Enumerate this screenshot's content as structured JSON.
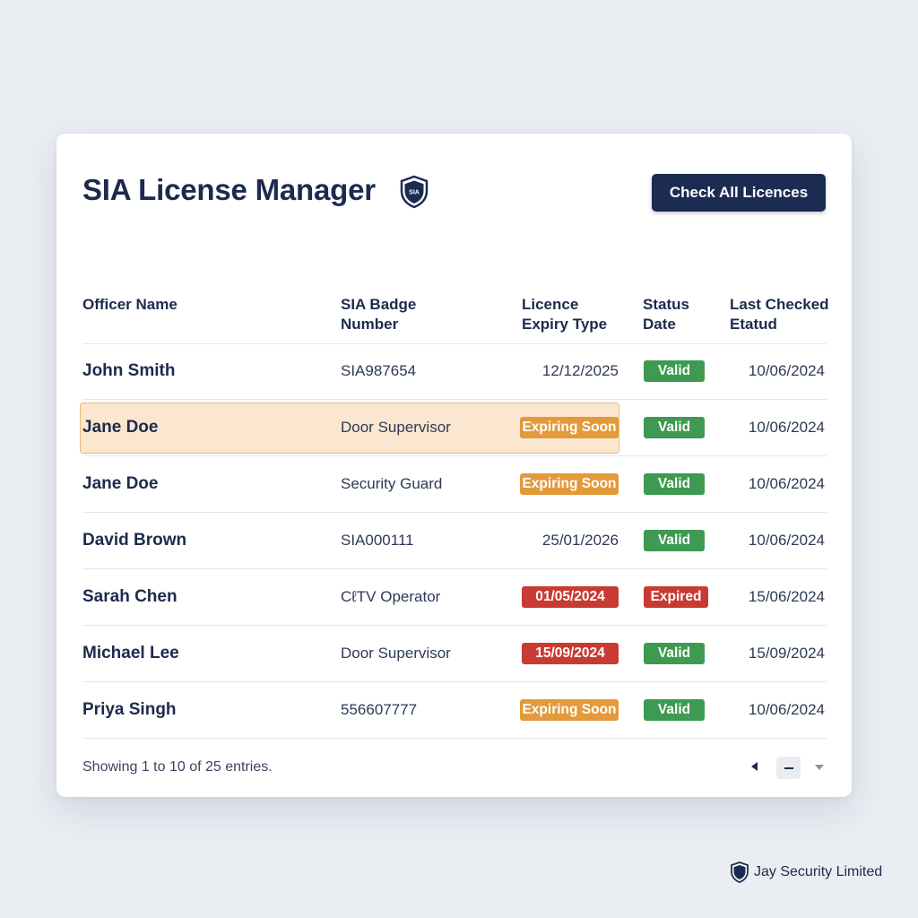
{
  "header": {
    "title": "SIA License Manager",
    "shield_badge_text": "SIA",
    "check_button_label": "Check All Licences"
  },
  "table": {
    "columns": [
      {
        "line1": "Officer Name",
        "line2": ""
      },
      {
        "line1": "SIA Badge",
        "line2": "Number"
      },
      {
        "line1": "Licence",
        "line2": "Expiry Type"
      },
      {
        "line1": "Status",
        "line2": "Date"
      },
      {
        "line1": "Last Checked",
        "line2": "Etatud"
      }
    ],
    "rows": [
      {
        "name": "John Smith",
        "badge": "SIA987654",
        "expiry": "12/12/2025",
        "expiry_style": "plain",
        "status": "Valid",
        "status_style": "valid",
        "checked": "10/06/2024",
        "highlighted": false
      },
      {
        "name": "Jane Doe",
        "badge": "Door Supervisor",
        "expiry": "Expiring Soon",
        "expiry_style": "orange",
        "status": "Valid",
        "status_style": "valid",
        "checked": "10/06/2024",
        "highlighted": true
      },
      {
        "name": "Jane Doe",
        "badge": "Security Guard",
        "expiry": "Expiring Soon",
        "expiry_style": "orange",
        "status": "Valid",
        "status_style": "valid",
        "checked": "10/06/2024",
        "highlighted": false
      },
      {
        "name": "David Brown",
        "badge": "SIA000111",
        "expiry": "25/01/2026",
        "expiry_style": "plain",
        "status": "Valid",
        "status_style": "valid",
        "checked": "10/06/2024",
        "highlighted": false
      },
      {
        "name": "Sarah Chen",
        "badge": "CℓTV Operator",
        "expiry": "01/05/2024",
        "expiry_style": "red",
        "status": "Expired",
        "status_style": "expired",
        "checked": "15/06/2024",
        "highlighted": false
      },
      {
        "name": "Michael Lee",
        "badge": "Door Supervisor",
        "expiry": "15/09/2024",
        "expiry_style": "red",
        "status": "Valid",
        "status_style": "valid",
        "checked": "15/09/2024",
        "highlighted": false
      },
      {
        "name": "Priya Singh",
        "badge": "556607777",
        "expiry": "Expiring Soon",
        "expiry_style": "orange",
        "status": "Valid",
        "status_style": "valid",
        "checked": "10/06/2024",
        "highlighted": false
      }
    ]
  },
  "footer": {
    "entries_text": "Showing 1 to 10 of 25 entries."
  },
  "brand": {
    "name": "Jay Security Limited"
  },
  "colors": {
    "navy": "#1c2b52",
    "valid_green": "#3d9a50",
    "expired_red": "#c93a32",
    "expiring_orange": "#e39a3a",
    "highlight_bg": "#fbe7d0"
  },
  "icons": {
    "title_icon": "shield-icon",
    "prev": "caret-left-icon",
    "next": "caret-down-icon",
    "brand": "shield-icon"
  }
}
